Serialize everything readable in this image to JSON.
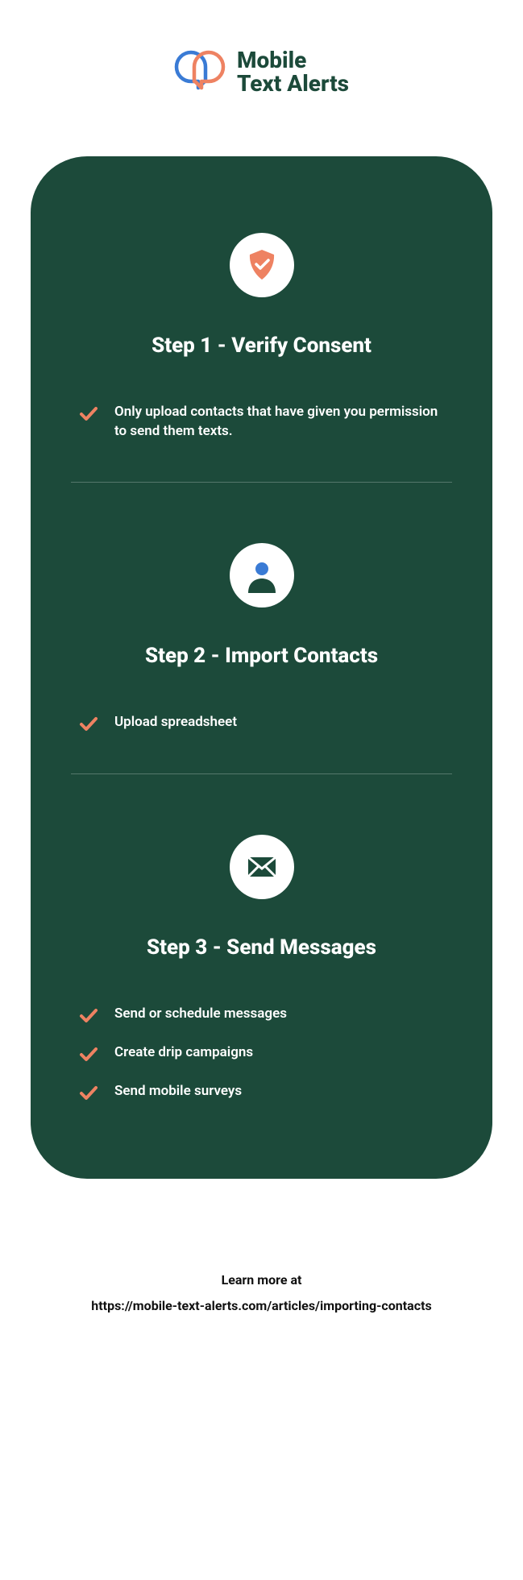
{
  "brand": {
    "line1": "Mobile",
    "line2": "Text Alerts"
  },
  "steps": [
    {
      "title": "Step 1 - Verify Consent",
      "items": [
        "Only upload contacts that have given you permission to send them texts."
      ]
    },
    {
      "title": "Step 2 - Import Contacts",
      "items": [
        "Upload spreadsheet"
      ]
    },
    {
      "title": "Step 3 - Send Messages",
      "items": [
        "Send or schedule messages",
        "Create drip campaigns",
        "Send mobile surveys"
      ]
    }
  ],
  "footer": {
    "line1": "Learn more at",
    "line2": "https://mobile-text-alerts.com/articles/importing-contacts"
  },
  "colors": {
    "accent": "#ee8262",
    "brandGreen": "#1c4a3a",
    "brandBlue": "#3a7bd5"
  }
}
